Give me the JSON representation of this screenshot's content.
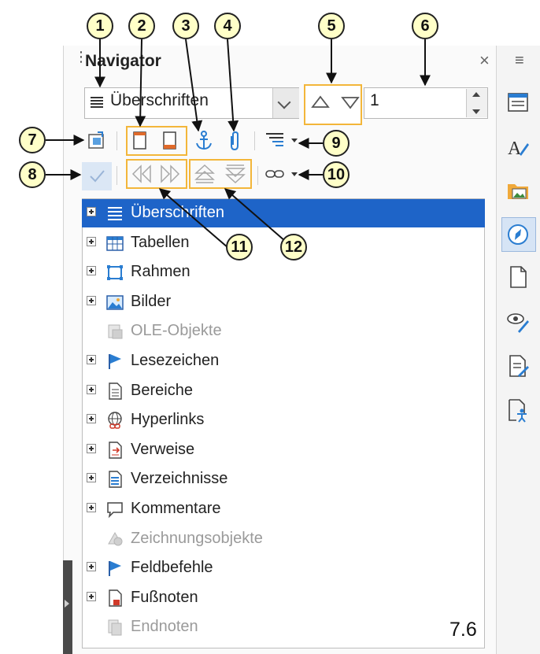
{
  "window": {
    "title": "Navigator",
    "close_glyph": "×",
    "menu_glyph": "≡"
  },
  "controls": {
    "category_select": {
      "value": "Überschriften",
      "icon": "headings-list-icon"
    },
    "previous_icon": "triangle-up-icon",
    "next_icon": "triangle-down-icon",
    "spin_value": "1"
  },
  "toolbar1": [
    {
      "name": "navigation-toggle-icon"
    },
    {
      "name": "page-header-icon"
    },
    {
      "name": "page-footer-icon"
    },
    {
      "name": "anchor-icon"
    },
    {
      "name": "footnote-endnote-icon"
    },
    {
      "name": "heading-levels-icon"
    },
    {
      "name": "dropdown-arrow-icon"
    }
  ],
  "toolbar2": [
    {
      "name": "drag-mode-check-icon"
    },
    {
      "name": "demote-chapter-icon"
    },
    {
      "name": "promote-chapter-icon"
    },
    {
      "name": "promote-level-icon"
    },
    {
      "name": "demote-level-icon"
    },
    {
      "name": "link-icon"
    },
    {
      "name": "dropdown-arrow-icon"
    }
  ],
  "callouts": [
    "1",
    "2",
    "3",
    "4",
    "5",
    "6",
    "7",
    "8",
    "9",
    "10",
    "11",
    "12"
  ],
  "tree": [
    {
      "label": "Überschriften",
      "icon": "headings-icon",
      "expandable": true,
      "selected": true,
      "enabled": true
    },
    {
      "label": "Tabellen",
      "icon": "table-icon",
      "expandable": true,
      "selected": false,
      "enabled": true
    },
    {
      "label": "Rahmen",
      "icon": "frame-icon",
      "expandable": true,
      "selected": false,
      "enabled": true
    },
    {
      "label": "Bilder",
      "icon": "image-icon",
      "expandable": true,
      "selected": false,
      "enabled": true
    },
    {
      "label": "OLE-Objekte",
      "icon": "ole-object-icon",
      "expandable": false,
      "selected": false,
      "enabled": false
    },
    {
      "label": "Lesezeichen",
      "icon": "bookmark-flag-icon",
      "expandable": true,
      "selected": false,
      "enabled": true
    },
    {
      "label": "Bereiche",
      "icon": "section-icon",
      "expandable": true,
      "selected": false,
      "enabled": true
    },
    {
      "label": "Hyperlinks",
      "icon": "hyperlink-globe-icon",
      "expandable": true,
      "selected": false,
      "enabled": true
    },
    {
      "label": "Verweise",
      "icon": "reference-icon",
      "expandable": true,
      "selected": false,
      "enabled": true
    },
    {
      "label": "Verzeichnisse",
      "icon": "index-icon",
      "expandable": true,
      "selected": false,
      "enabled": true
    },
    {
      "label": "Kommentare",
      "icon": "comment-icon",
      "expandable": true,
      "selected": false,
      "enabled": true
    },
    {
      "label": "Zeichnungsobjekte",
      "icon": "drawing-object-icon",
      "expandable": false,
      "selected": false,
      "enabled": false
    },
    {
      "label": "Feldbefehle",
      "icon": "field-flag-icon",
      "expandable": true,
      "selected": false,
      "enabled": true
    },
    {
      "label": "Fußnoten",
      "icon": "footnote-icon",
      "expandable": true,
      "selected": false,
      "enabled": true
    },
    {
      "label": "Endnoten",
      "icon": "endnote-icon",
      "expandable": false,
      "selected": false,
      "enabled": false
    }
  ],
  "version_label": "7.6",
  "sidebar_icons": [
    "properties-icon",
    "styles-icon",
    "gallery-icon",
    "navigator-icon",
    "page-icon",
    "style-inspector-icon",
    "manage-changes-icon",
    "accessibility-check-icon"
  ],
  "colors": {
    "selection": "#1e64c8",
    "highlight_border": "#f3b63a",
    "callout_fill": "#ffffc8",
    "icon_blue": "#2a7dd1"
  }
}
